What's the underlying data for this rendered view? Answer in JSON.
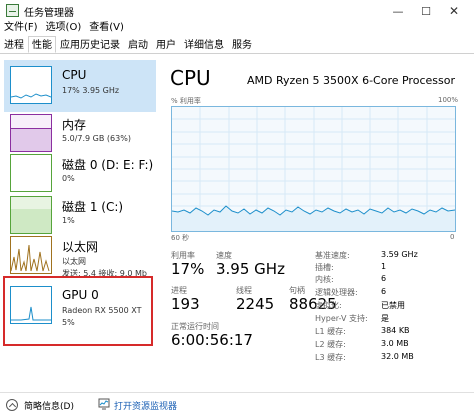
{
  "window": {
    "title": "任务管理器",
    "controls": {
      "minimize": "—",
      "maximize": "☐",
      "close": "✕"
    }
  },
  "menu": [
    "文件(F)",
    "选项(O)",
    "查看(V)"
  ],
  "tabs": [
    "进程",
    "性能",
    "应用历史记录",
    "启动",
    "用户",
    "详细信息",
    "服务"
  ],
  "active_tab": "性能",
  "sidebar": {
    "items": [
      {
        "name": "CPU",
        "detail": "17%  3.95 GHz",
        "detail2": ""
      },
      {
        "name": "内存",
        "detail": "5.0/7.9 GB (63%)",
        "detail2": ""
      },
      {
        "name": "磁盘 0 (D: E: F:)",
        "detail": "0%",
        "detail2": ""
      },
      {
        "name": "磁盘 1 (C:)",
        "detail": "1%",
        "detail2": ""
      },
      {
        "name": "以太网",
        "detail": "以太网",
        "detail2": "发送: 5.4  接收: 9.0 Mb"
      },
      {
        "name": "GPU 0",
        "detail": "Radeon RX 5500 XT",
        "detail2": "5%"
      }
    ]
  },
  "main": {
    "title": "CPU",
    "processor": "AMD Ryzen 5 3500X 6-Core Processor",
    "graph": {
      "label_left": "% 利用率",
      "label_right": "100%",
      "axis_left": "60 秒",
      "axis_right": "0"
    },
    "stats": {
      "utilization_label": "利用率",
      "utilization": "17%",
      "speed_label": "速度",
      "speed": "3.95 GHz",
      "processes_label": "进程",
      "processes": "193",
      "threads_label": "线程",
      "threads": "2245",
      "handles_label": "句柄",
      "handles": "88625",
      "uptime_label": "正常运行时间",
      "uptime": "6:00:56:17"
    },
    "specs": [
      {
        "label": "基准速度:",
        "value": "3.59 GHz"
      },
      {
        "label": "插槽:",
        "value": "1"
      },
      {
        "label": "内核:",
        "value": "6"
      },
      {
        "label": "逻辑处理器:",
        "value": "6"
      },
      {
        "label": "虚拟化:",
        "value": "已禁用"
      },
      {
        "label": "Hyper-V 支持:",
        "value": "是"
      },
      {
        "label": "L1 缓存:",
        "value": "384 KB"
      },
      {
        "label": "L2 缓存:",
        "value": "3.0 MB"
      },
      {
        "label": "L3 缓存:",
        "value": "32.0 MB"
      }
    ]
  },
  "footer": {
    "brief": "简略信息(D)",
    "monitor": "打开资源监视器"
  },
  "colors": {
    "accent": "#1d8fcb",
    "selected_bg": "#cde4f7",
    "highlight_border": "#d62a2a"
  }
}
